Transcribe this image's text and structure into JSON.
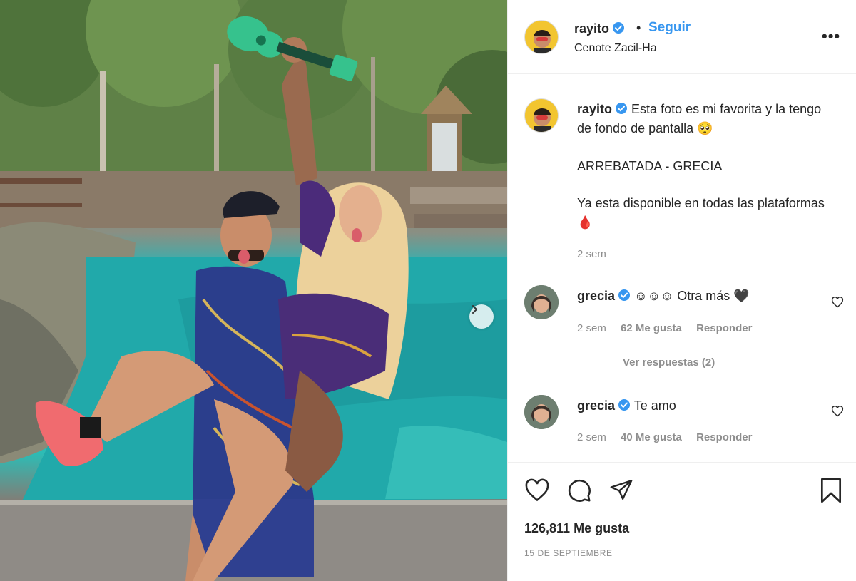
{
  "post": {
    "author": "rayito",
    "follow_label": "Seguir",
    "separator": "•",
    "location": "Cenote Zacil-Ha",
    "more_label": "•••",
    "image_alt": "Pareja posando frente a un cenote con un ukelele verde"
  },
  "caption": {
    "author": "rayito",
    "line1": "Esta foto es mi favorita y la tengo de fondo de pantalla 🥺",
    "line2": "ARREBATADA - GRECIA",
    "line3": "Ya esta disponible en todas las plataformas 🩸",
    "time": "2 sem"
  },
  "comments": [
    {
      "author": "grecia",
      "text": "☺☺☺ Otra más 🖤",
      "time": "2 sem",
      "likes": "62 Me gusta",
      "reply_label": "Responder",
      "view_replies": "Ver respuestas (2)"
    },
    {
      "author": "grecia",
      "text": "Te amo",
      "time": "2 sem",
      "likes": "40 Me gusta",
      "reply_label": "Responder"
    }
  ],
  "footer": {
    "likes": "126,811 Me gusta",
    "date": "15 DE SEPTIEMBRE"
  },
  "colors": {
    "link": "#3897f0",
    "verified": "#3897f0",
    "muted": "#8e8e8e"
  }
}
